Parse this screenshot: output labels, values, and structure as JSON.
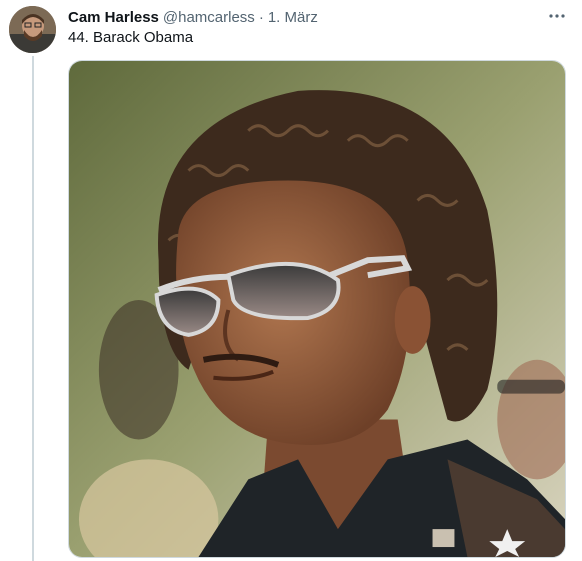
{
  "tweet": {
    "display_name": "Cam Harless",
    "handle": "@hamcarless",
    "separator": "·",
    "date": "1. März",
    "text": "44. Barack Obama",
    "more_icon": "more-horizontal-icon"
  },
  "media": {
    "kind": "photo",
    "subject": "man-with-curly-hair-and-aviator-sunglasses"
  },
  "colors": {
    "text_primary": "#0f1419",
    "text_secondary": "#536471",
    "thread_line": "#cfd9de"
  }
}
